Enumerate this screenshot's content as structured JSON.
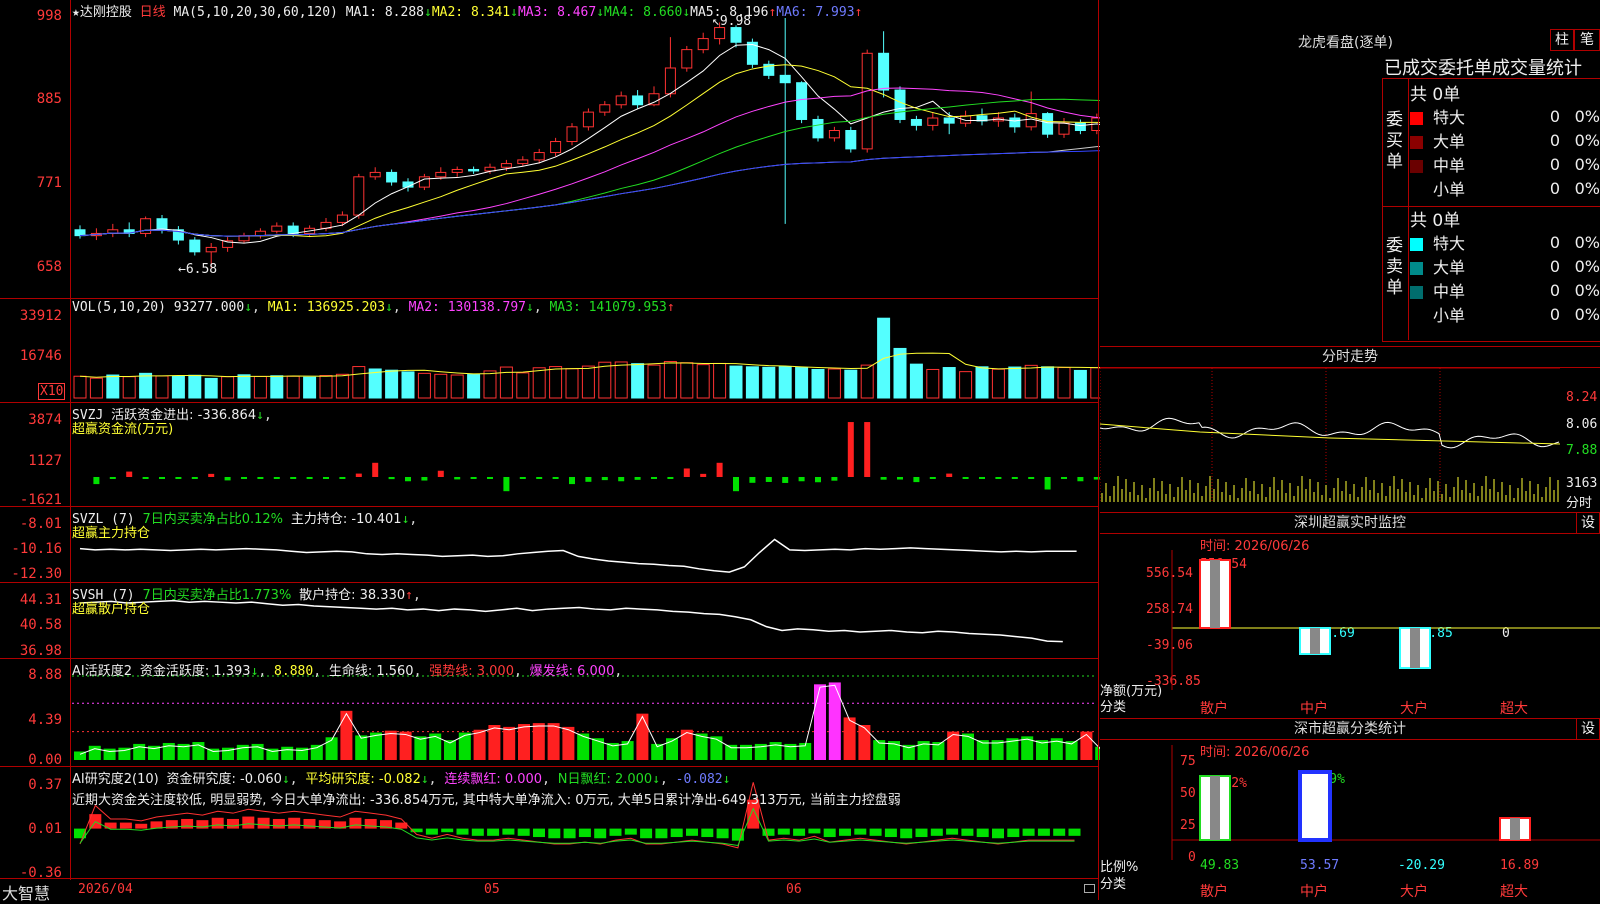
{
  "chart_title": {
    "star": "★",
    "name": "达刚控股",
    "period": "日线",
    "ma_label": "MA(5,10,20,30,60,120)",
    "ma1": "MA1: 8.288",
    "ma1_arrow": "↓",
    "ma2": "MA2: 8.341",
    "ma2_arrow": "↓",
    "ma3": "MA3: 8.467",
    "ma3_arrow": "↓",
    "ma4": "MA4: 8.660",
    "ma4_arrow": "↓",
    "ma5": "MA5: 8.196",
    "ma5_arrow": "↑",
    "ma6": "MA6: 7.993",
    "ma6_arrow": "↑"
  },
  "price_axis": [
    "998",
    "885",
    "771",
    "658"
  ],
  "price_annotations": {
    "high": "9.98",
    "low": "6.58"
  },
  "vol_header": {
    "label": "VOL(5,10,20)",
    "value": "93277.000",
    "value_arrow": "↓",
    "ma1": "MA1: 136925.203",
    "ma1_arrow": "↓",
    "ma2": "MA2: 130138.797",
    "ma2_arrow": "↓",
    "ma3": "MA3: 141079.953",
    "ma3_arrow": "↑"
  },
  "vol_axis": [
    "33912",
    "16746"
  ],
  "vol_unit": "X10",
  "svzj_header": {
    "label": "SVZJ",
    "text": "活跃资金进出: -336.864",
    "arrow": "↓",
    "sub": "超赢资金流(万元)"
  },
  "svzj_axis": [
    "3874",
    "1127",
    "-1621"
  ],
  "svzl_header": {
    "label": "SVZL (7)",
    "ratio": "7日内买卖净占比0.12%",
    "pos": "主力持仓: -10.401",
    "arrow": "↓",
    "sub": "超赢主力持仓"
  },
  "svzl_axis": [
    "-8.01",
    "-10.16",
    "-12.30"
  ],
  "svsh_header": {
    "label": "SVSH (7)",
    "ratio": "7日内买卖净占比1.773%",
    "pos": "散户持仓: 38.330",
    "arrow": "↑",
    "sub": "超赢散户持仓"
  },
  "svsh_axis": [
    "44.31",
    "40.58",
    "36.98"
  ],
  "ai_active_header": {
    "label": "AI活跃度2",
    "act": "资金活跃度: 1.393",
    "act_arrow": "↓",
    "act2": "8.880",
    "life": "生命线: 1.560",
    "strong": "强势线: 3.000",
    "burst": "爆发线: 6.000"
  },
  "ai_active_axis": [
    "8.88",
    "4.39",
    "0.00"
  ],
  "ai_research_header": {
    "label": "AI研究度2(10)",
    "res": "资金研究度: -0.060",
    "res_arrow": "↓",
    "avg": "平均研究度: -0.082",
    "avg_arrow": "↓",
    "cont": "连续飘红: 0.000",
    "nday": "N日飘红: 2.000",
    "nday_arrow": "↓",
    "last": "-0.082",
    "last_arrow": "↓",
    "comment": "近期大资金关注度较低, 明显弱势, 今日大单净流出: -336.854万元, 其中特大单净流入: 0万元, 大单5日累计净出-649.313万元, 当前主力控盘弱"
  },
  "ai_research_axis": [
    "0.37",
    "0.01",
    "-0.36"
  ],
  "bottom_bar": {
    "brand": "大智慧",
    "date": "2026/04",
    "m05": "05",
    "m06": "06"
  },
  "right": {
    "dragon_title": "龙虎看盘(逐单)",
    "btn_zhu": "柱",
    "btn_bi": "笔",
    "stats_title": "已成交委托单成交量统计",
    "buy_label": "委买单",
    "sell_label": "委卖单",
    "buy_total": "共 0单",
    "sell_total": "共 0单",
    "rows": [
      "特大",
      "大单",
      "中单",
      "小单"
    ],
    "buy_values": [
      "0",
      "0",
      "0",
      "0"
    ],
    "buy_pcts": [
      "0%",
      "0%",
      "0%",
      "0%"
    ],
    "sell_values": [
      "0",
      "0",
      "0",
      "0"
    ],
    "sell_pcts": [
      "0%",
      "0%",
      "0%",
      "0%"
    ],
    "intraday_title": "分时走势",
    "intraday_axis": [
      "8.24",
      "8.06",
      "7.88"
    ],
    "intraday_vol": "3163",
    "intraday_vol_label": "分时",
    "monitor_title": "深圳超赢实时监控",
    "monitor_time": "时间: 2026/06/26",
    "monitor_axis": [
      "556.54",
      "258.74",
      "-39.06",
      "-336.85"
    ],
    "monitor_values": [
      "556.54",
      "-219.69",
      "-336.85",
      "0"
    ],
    "monitor_y_label": "净额(万元)",
    "monitor_x_label": "分类",
    "categories": [
      "散户",
      "中户",
      "大户",
      "超大"
    ],
    "classify_title": "深市超赢分类统计",
    "classify_time": "时间: 2026/06/26",
    "classify_axis": [
      "75",
      "50",
      "25",
      "0"
    ],
    "classify_top": [
      "+0.22%",
      "-0.09%"
    ],
    "classify_bottom": [
      "49.83",
      "53.57",
      "-20.29",
      "16.89"
    ],
    "classify_y_label": "比例%",
    "classify_x_label": "分类",
    "settings_btn": "设"
  },
  "chart_data": [
    {
      "type": "candlestick",
      "title": "达刚控股 日线",
      "ylim": [
        6.58,
        9.98
      ],
      "ticks": [
        9.98,
        8.85,
        7.71,
        6.58
      ],
      "candles": [
        [
          7.1,
          7.02,
          7.16,
          6.98
        ],
        [
          7.02,
          7.05,
          7.12,
          6.96
        ],
        [
          7.05,
          7.1,
          7.18,
          7.0
        ],
        [
          7.1,
          7.05,
          7.2,
          7.0
        ],
        [
          7.05,
          7.25,
          7.28,
          7.0
        ],
        [
          7.25,
          7.1,
          7.3,
          7.05
        ],
        [
          7.1,
          6.96,
          7.15,
          6.9
        ],
        [
          6.96,
          6.8,
          7.0,
          6.75
        ],
        [
          6.8,
          6.86,
          6.92,
          6.58
        ],
        [
          6.86,
          6.95,
          7.0,
          6.8
        ],
        [
          6.95,
          7.02,
          7.06,
          6.92
        ],
        [
          7.02,
          7.08,
          7.12,
          6.98
        ],
        [
          7.08,
          7.15,
          7.2,
          7.05
        ],
        [
          7.15,
          7.05,
          7.2,
          7.0
        ],
        [
          7.05,
          7.12,
          7.16,
          7.0
        ],
        [
          7.12,
          7.2,
          7.26,
          7.08
        ],
        [
          7.2,
          7.3,
          7.35,
          7.15
        ],
        [
          7.3,
          7.82,
          7.86,
          7.25
        ],
        [
          7.82,
          7.88,
          7.95,
          7.78
        ],
        [
          7.88,
          7.75,
          7.92,
          7.7
        ],
        [
          7.75,
          7.68,
          7.8,
          7.62
        ],
        [
          7.68,
          7.82,
          7.86,
          7.64
        ],
        [
          7.82,
          7.88,
          7.95,
          7.78
        ],
        [
          7.88,
          7.92,
          7.96,
          7.82
        ],
        [
          7.92,
          7.9,
          7.96,
          7.86
        ],
        [
          7.9,
          7.95,
          8.0,
          7.86
        ],
        [
          7.95,
          8.0,
          8.05,
          7.9
        ],
        [
          8.0,
          8.05,
          8.1,
          7.96
        ],
        [
          8.05,
          8.15,
          8.2,
          8.0
        ],
        [
          8.15,
          8.3,
          8.35,
          8.1
        ],
        [
          8.3,
          8.5,
          8.55,
          8.25
        ],
        [
          8.5,
          8.7,
          8.75,
          8.45
        ],
        [
          8.7,
          8.8,
          8.85,
          8.65
        ],
        [
          8.8,
          8.92,
          8.98,
          8.75
        ],
        [
          8.92,
          8.8,
          9.0,
          8.75
        ],
        [
          8.8,
          8.95,
          9.05,
          8.78
        ],
        [
          8.95,
          9.3,
          9.72,
          8.9
        ],
        [
          9.3,
          9.55,
          9.6,
          9.25
        ],
        [
          9.55,
          9.7,
          9.78,
          9.5
        ],
        [
          9.7,
          9.85,
          9.92,
          9.62
        ],
        [
          9.85,
          9.65,
          9.88,
          9.58
        ],
        [
          9.65,
          9.35,
          9.7,
          9.3
        ],
        [
          9.35,
          9.2,
          9.4,
          9.15
        ],
        [
          9.2,
          9.1,
          9.98,
          7.18
        ],
        [
          9.1,
          8.6,
          9.12,
          8.55
        ],
        [
          8.6,
          8.35,
          8.65,
          8.3
        ],
        [
          8.35,
          8.45,
          8.5,
          8.3
        ],
        [
          8.45,
          8.2,
          8.5,
          8.15
        ],
        [
          8.2,
          9.5,
          9.55,
          8.15
        ],
        [
          9.5,
          9.0,
          9.8,
          8.9
        ],
        [
          9.0,
          8.6,
          9.05,
          8.55
        ],
        [
          8.6,
          8.52,
          8.65,
          8.45
        ],
        [
          8.52,
          8.62,
          8.7,
          8.45
        ],
        [
          8.62,
          8.55,
          8.7,
          8.4
        ],
        [
          8.55,
          8.65,
          8.72,
          8.5
        ],
        [
          8.65,
          8.58,
          8.75,
          8.52
        ],
        [
          8.58,
          8.62,
          8.7,
          8.5
        ],
        [
          8.62,
          8.5,
          8.68,
          8.42
        ],
        [
          8.5,
          8.68,
          8.98,
          8.45
        ],
        [
          8.68,
          8.4,
          8.7,
          8.35
        ],
        [
          8.4,
          8.55,
          8.62,
          8.35
        ],
        [
          8.55,
          8.45,
          8.6,
          8.4
        ],
        [
          8.45,
          8.62,
          8.68,
          8.4
        ],
        [
          8.62,
          8.48,
          8.66,
          8.4
        ],
        [
          8.48,
          8.6,
          8.65,
          8.42
        ],
        [
          8.6,
          8.55,
          8.72,
          8.48
        ],
        [
          8.55,
          8.4,
          8.8,
          8.35
        ],
        [
          8.4,
          8.05,
          8.45,
          8.0
        ],
        [
          8.05,
          7.9,
          8.1,
          7.85
        ]
      ]
    },
    {
      "type": "bar",
      "title": "VOL(5,10,20)",
      "ylim": [
        0,
        33912
      ],
      "values": [
        9000,
        8200,
        9500,
        8800,
        10200,
        9100,
        8900,
        9400,
        8100,
        8800,
        9600,
        8900,
        9200,
        9000,
        8600,
        9300,
        9800,
        13000,
        12000,
        11500,
        10800,
        10200,
        9800,
        9500,
        9700,
        11200,
        12800,
        10400,
        12500,
        13000,
        12100,
        13200,
        14800,
        14900,
        14200,
        13600,
        15100,
        14600,
        13800,
        14300,
        13200,
        12900,
        12700,
        13000,
        12600,
        11800,
        12000,
        11500,
        13600,
        33000,
        20500,
        14000,
        11800,
        12600,
        10900,
        12900,
        11900,
        12800,
        13500,
        12900,
        12600,
        11400,
        12500,
        13600,
        14200,
        13900,
        12200,
        17500,
        9300
      ],
      "red": [
        1,
        1,
        0,
        1,
        0,
        1,
        0,
        0,
        0,
        1,
        0,
        1,
        0,
        1,
        0,
        1,
        1,
        1,
        0,
        0,
        0,
        1,
        1,
        1,
        0,
        1,
        1,
        1,
        1,
        1,
        1,
        1,
        1,
        1,
        0,
        1,
        1,
        1,
        1,
        1,
        0,
        0,
        0,
        0,
        0,
        0,
        1,
        0,
        1,
        0,
        0,
        0,
        1,
        0,
        1,
        0,
        1,
        0,
        1,
        0,
        1,
        0,
        1,
        0,
        1,
        0,
        0,
        0,
        0
      ]
    },
    {
      "type": "bar",
      "title": "SVZJ 活跃资金进出",
      "ylim": [
        -1621,
        3874
      ],
      "values": [
        0,
        -500,
        -90,
        380,
        -60,
        -60,
        -110,
        -80,
        220,
        -240,
        -60,
        -90,
        -80,
        -60,
        -60,
        -70,
        -70,
        240,
        1000,
        -150,
        -300,
        -250,
        440,
        -170,
        -120,
        -40,
        -1000,
        -60,
        -120,
        -90,
        -500,
        -340,
        -220,
        -300,
        -200,
        -100,
        -130,
        600,
        220,
        1000,
        -1000,
        -410,
        -350,
        -420,
        -300,
        -370,
        -260,
        3870,
        3870,
        -190,
        -180,
        -360,
        -90,
        240,
        -80,
        -80,
        -70,
        -80,
        -120,
        -880,
        -60,
        -300,
        -180,
        300,
        -450,
        -60,
        -80,
        -80,
        -336
      ]
    },
    {
      "type": "line",
      "title": "SVZL 主力持仓",
      "ylim": [
        -12.3,
        -8.01
      ],
      "values": [
        -10.2,
        -10.3,
        -10.25,
        -10.3,
        -10.25,
        -10.3,
        -10.35,
        -10.3,
        -10.25,
        -10.3,
        -10.25,
        -10.2,
        -10.25,
        -10.3,
        -10.4,
        -10.5,
        -10.45,
        -10.4,
        -10.45,
        -10.6,
        -10.65,
        -10.6,
        -10.65,
        -10.7,
        -10.8,
        -10.75,
        -10.7,
        -10.8,
        -10.75,
        -10.6,
        -10.5,
        -10.4,
        -10.35,
        -10.8,
        -11.0,
        -11.15,
        -11.25,
        -11.35,
        -11.4,
        -11.5,
        -11.55,
        -11.75,
        -11.9,
        -12.0,
        -11.6,
        -10.5,
        -9.5,
        -10.3,
        -10.35,
        -10.3,
        -10.25,
        -10.3,
        -10.2,
        -10.25,
        -10.2,
        -10.15,
        -10.2,
        -10.25,
        -10.3,
        -10.35,
        -10.4,
        -10.45,
        -10.4,
        -10.45,
        -10.4,
        -10.4,
        -10.401
      ]
    },
    {
      "type": "line",
      "title": "SVSH 散户持仓",
      "ylim": [
        36.98,
        44.31
      ],
      "values": [
        43.4,
        43.5,
        43.6,
        43.4,
        43.5,
        43.6,
        43.7,
        43.5,
        43.6,
        43.5,
        43.4,
        43.5,
        43.3,
        43.1,
        43.2,
        43.0,
        42.9,
        42.8,
        42.7,
        42.6,
        42.7,
        42.5,
        42.6,
        42.4,
        42.6,
        42.5,
        42.3,
        42.5,
        42.7,
        42.4,
        42.6,
        42.7,
        42.8,
        42.6,
        42.5,
        42.7,
        42.6,
        42.5,
        42.3,
        42.2,
        42.0,
        41.9,
        41.6,
        41.2,
        40.3,
        39.8,
        40.0,
        39.9,
        39.7,
        39.8,
        39.6,
        39.7,
        39.8,
        39.6,
        39.5,
        39.7,
        39.6,
        39.4,
        39.3,
        39.2,
        39.0,
        38.8,
        38.4,
        38.33
      ]
    },
    {
      "type": "bar",
      "title": "AI活跃度2",
      "ylim": [
        0,
        8.88
      ],
      "values": [
        0.9,
        1.5,
        1.2,
        1.3,
        1.7,
        1.5,
        1.8,
        1.7,
        1.9,
        1.2,
        1.3,
        1.6,
        1.7,
        1.2,
        1.4,
        1.3,
        1.6,
        2.4,
        5.2,
        2.6,
        2.9,
        3.1,
        3.0,
        2.5,
        2.8,
        2.1,
        2.9,
        3.2,
        3.7,
        3.5,
        3.8,
        3.9,
        3.9,
        3.5,
        2.8,
        2.3,
        1.8,
        2.0,
        4.9,
        1.7,
        2.3,
        3.2,
        2.8,
        2.5,
        1.6,
        1.6,
        1.7,
        1.9,
        1.7,
        1.8,
        8.0,
        8.2,
        4.5,
        3.7,
        2.1,
        2.0,
        1.6,
        2.0,
        1.9,
        3.0,
        2.8,
        2.1,
        2.1,
        2.3,
        2.5,
        2.1,
        2.3,
        2.0,
        3.0,
        1.4
      ]
    },
    {
      "type": "bar",
      "title": "AI研究度2(10)",
      "ylim": [
        -0.36,
        0.37
      ],
      "values": [
        -0.08,
        0.12,
        0.05,
        0.05,
        0.04,
        0.06,
        0.07,
        0.08,
        0.07,
        0.09,
        0.08,
        0.1,
        0.09,
        0.08,
        0.09,
        0.08,
        0.07,
        0.06,
        0.09,
        0.08,
        0.07,
        0.05,
        -0.03,
        -0.05,
        -0.03,
        -0.05,
        -0.06,
        -0.06,
        -0.05,
        -0.06,
        -0.07,
        -0.08,
        -0.08,
        -0.07,
        -0.08,
        -0.06,
        -0.05,
        -0.08,
        -0.08,
        -0.07,
        -0.06,
        -0.07,
        -0.08,
        -0.1,
        0.24,
        -0.06,
        -0.05,
        -0.06,
        -0.04,
        -0.07,
        -0.06,
        -0.05,
        -0.06,
        -0.07,
        -0.08,
        -0.07,
        -0.06,
        -0.05,
        -0.06,
        -0.07,
        -0.08,
        -0.07,
        -0.06,
        -0.06,
        -0.06,
        -0.06
      ]
    }
  ]
}
